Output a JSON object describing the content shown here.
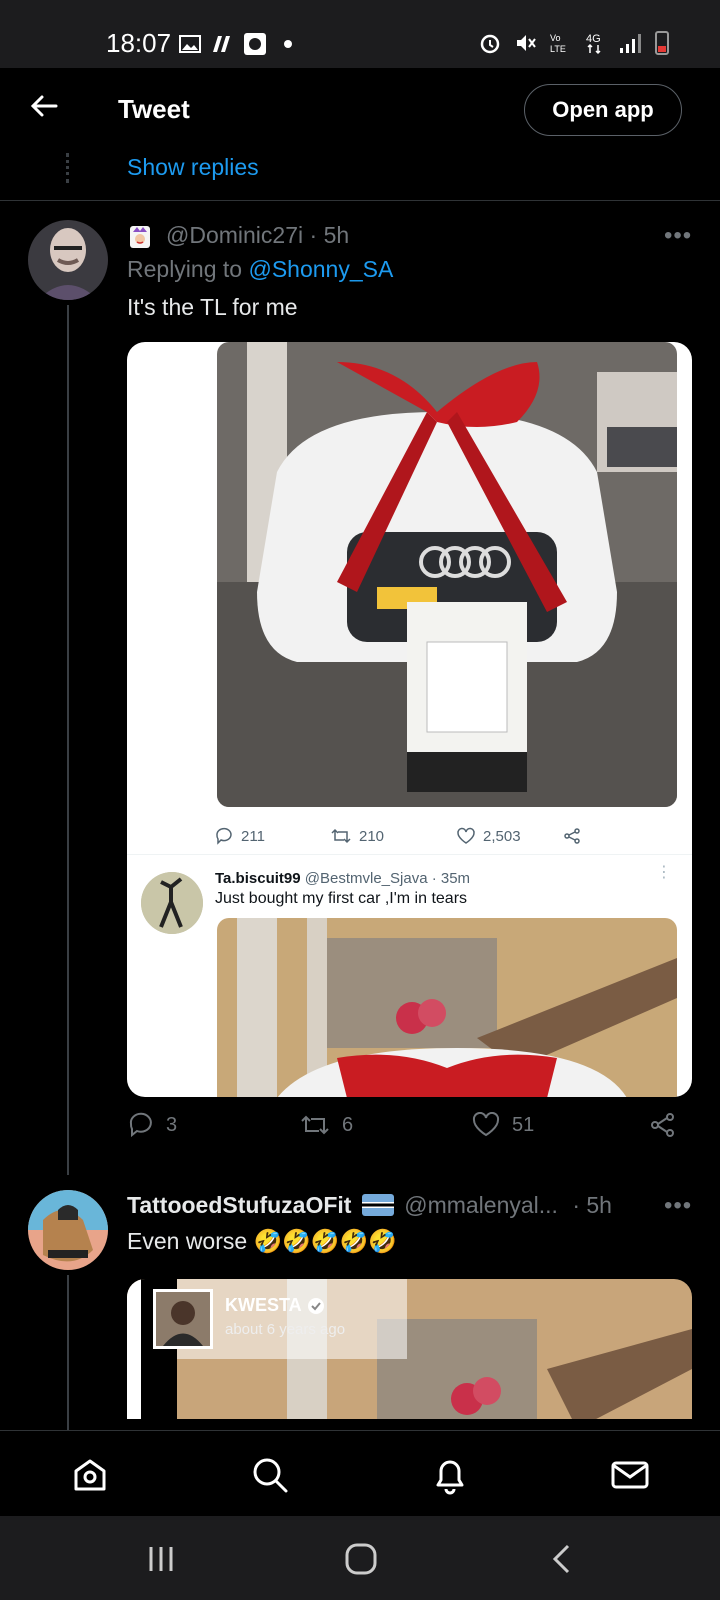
{
  "status_bar": {
    "time": "18:07"
  },
  "header": {
    "title": "Tweet",
    "open_app_label": "Open app"
  },
  "thread": {
    "show_replies_label": "Show replies"
  },
  "tweet1": {
    "handle": "@Dominic27i",
    "time": "· 5h",
    "replying_label": "Replying to",
    "replying_to": "@Shonny_SA",
    "text": "It's the TL for me",
    "embed": {
      "stats": {
        "replies": "211",
        "retweets": "210",
        "likes": "2,503"
      },
      "author_name": "Ta.biscuit99",
      "author_handle": "@Bestmvle_Sjava · 35m",
      "text": "Just bought my first car ,I'm in tears"
    },
    "actions": {
      "replies": "3",
      "retweets": "6",
      "likes": "51"
    }
  },
  "tweet2": {
    "name": "TattooedStufuzaOFit",
    "handle": "@mmalenyal...",
    "time": "· 5h",
    "text": "Even worse 🤣🤣🤣🤣🤣",
    "embed": {
      "author_name": "KWESTA",
      "author_meta": "about 6 years ago"
    }
  },
  "colors": {
    "link": "#1d9bf0",
    "muted": "#71767b",
    "background": "#000000"
  }
}
